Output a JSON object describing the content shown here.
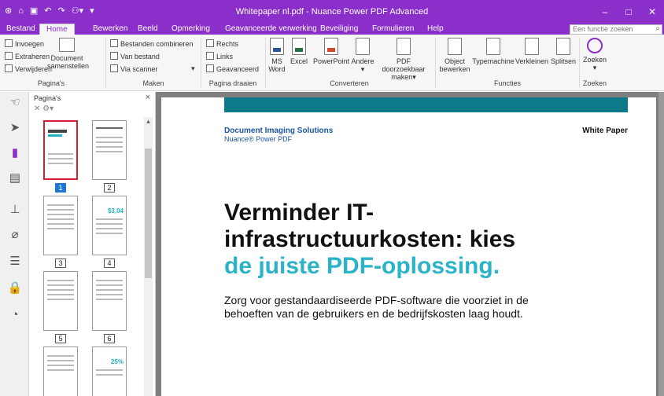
{
  "window": {
    "title": "Whitepaper nl.pdf - Nuance Power PDF Advanced",
    "min_glyph": "–",
    "max_glyph": "□",
    "close_glyph": "✕"
  },
  "qat": {
    "logo": "⊛",
    "open": "⌂",
    "save": "▣",
    "undo": "↶",
    "redo": "↷",
    "user": "⚇▾",
    "more": "▾"
  },
  "tabs": [
    {
      "label": "Bestand"
    },
    {
      "label": "Home"
    },
    {
      "label": "Bewerken"
    },
    {
      "label": "Beeld"
    },
    {
      "label": "Opmerking"
    },
    {
      "label": "Geavanceerde verwerking"
    },
    {
      "label": "Beveiliging"
    },
    {
      "label": "Formulieren"
    },
    {
      "label": "Help"
    }
  ],
  "search": {
    "placeholder": "Een functie zoeken",
    "icon": "⌕"
  },
  "ribbon": {
    "paginas": {
      "label": "Pagina's",
      "invoegen": "Invoegen",
      "extraheren": "Extraheren",
      "verwijderen": "Verwijderen",
      "document1": "Document",
      "document2": "samenstellen"
    },
    "maken": {
      "label": "Maken",
      "combineren": "Bestanden combineren",
      "van_bestand": "Van bestand",
      "scanner": "Via scanner",
      "more": "▾"
    },
    "draaien": {
      "label": "Pagina draaien",
      "rechts": "Rechts",
      "links": "Links",
      "geavanceerd": "Geavanceerd"
    },
    "converteren": {
      "label": "Converteren",
      "ms1": "MS",
      "ms2": "Word",
      "excel": "Excel",
      "powerpoint": "PowerPoint",
      "andere": "Andere",
      "andere_dd": "▾",
      "pdf1": "PDF doorzoekbaar",
      "pdf2": "maken",
      "pdf_dd": "▾"
    },
    "functies": {
      "label": "Functies",
      "object1": "Object",
      "object2": "bewerken",
      "typemachine": "Typemachine",
      "verkleinen": "Verkleinen",
      "splitsen": "Splitsen"
    },
    "zoeken": {
      "label": "Zoeken",
      "zoeken": "Zoeken",
      "dd": "▾"
    }
  },
  "lefttools": {
    "hand": "☜",
    "select": "➤",
    "bookmark": "▮",
    "pages": "▤",
    "stamp": "⊥",
    "attach": "⌀",
    "comment": "☰",
    "lock": "🔒",
    "shapes": "◔"
  },
  "panel": {
    "title": "Pagina's",
    "close": "×",
    "tools": "✕ ⚙▾",
    "scroll_up": "▲"
  },
  "pages": [
    {
      "num": "1"
    },
    {
      "num": "2"
    },
    {
      "num": "3"
    },
    {
      "num": "4"
    },
    {
      "num": "5"
    },
    {
      "num": "6"
    }
  ],
  "thumbs_extra": {
    "p4_big": "$3,04",
    "p8_big": "25%"
  },
  "document": {
    "company": "Document Imaging Solutions",
    "product": "Nuance® Power PDF",
    "whitepaper": "White Paper",
    "headline1": "Verminder IT-",
    "headline2": "infrastructuurkosten: kies",
    "headline3": "de juiste PDF-oplossing.",
    "intro": "Zorg voor gestandaardiseerde PDF-software die voorziet in de behoeften van de gebruikers en de bedrijfskosten laag houdt."
  },
  "colors": {
    "accent": "#8a2fc9",
    "teal": "#2bb3c8",
    "selected_page": "#d1202f"
  }
}
